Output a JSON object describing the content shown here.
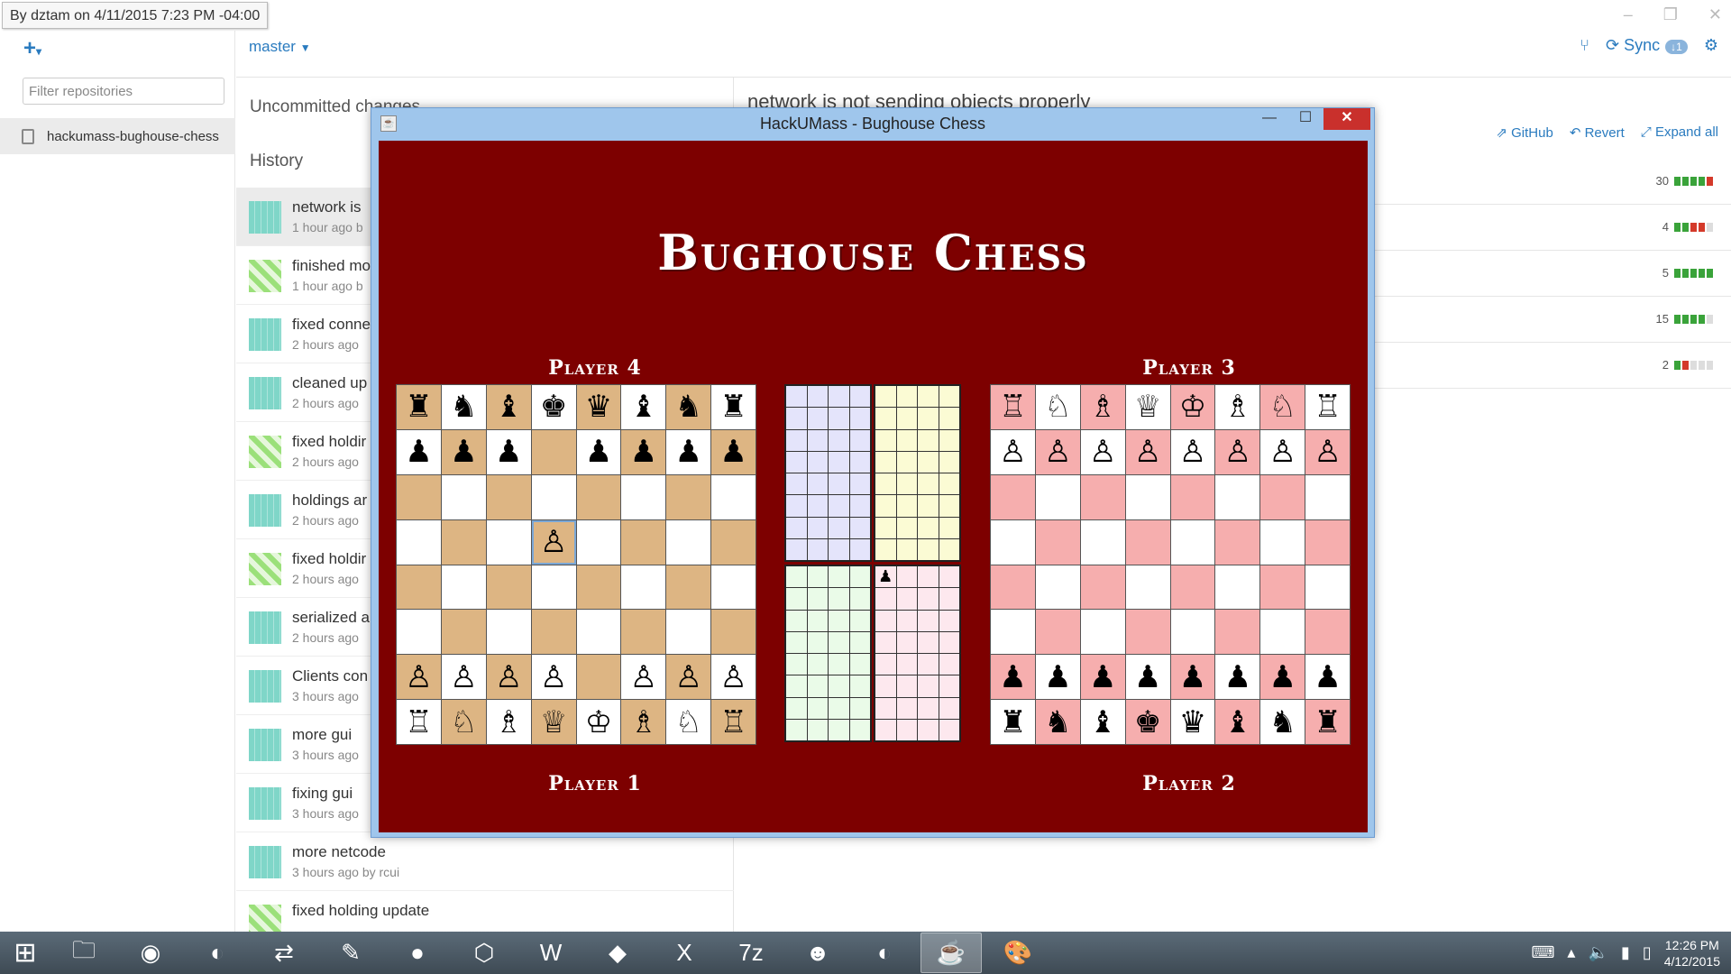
{
  "tooltip": "By dztam on 4/11/2015 7:23 PM -04:00",
  "left_panel": {
    "filter_placeholder": "Filter repositories",
    "repo_name": "hackumass-bughouse-chess"
  },
  "toolbar": {
    "branch": "master",
    "sync_label": "Sync",
    "sync_badge": "1"
  },
  "middle": {
    "uncommitted_label": "Uncommitted changes",
    "history_label": "History",
    "commits": [
      {
        "title": "network is",
        "meta": "1 hour ago b",
        "avatar": "a"
      },
      {
        "title": "finished mo",
        "meta": "1 hour ago b",
        "avatar": "b"
      },
      {
        "title": "fixed conne",
        "meta": "2 hours ago",
        "avatar": "a"
      },
      {
        "title": "cleaned up",
        "meta": "2 hours ago",
        "avatar": "a"
      },
      {
        "title": "fixed holdir",
        "meta": "2 hours ago",
        "avatar": "b"
      },
      {
        "title": "holdings ar",
        "meta": "2 hours ago",
        "avatar": "a"
      },
      {
        "title": "fixed holdir",
        "meta": "2 hours ago",
        "avatar": "b"
      },
      {
        "title": "serialized a",
        "meta": "2 hours ago",
        "avatar": "a"
      },
      {
        "title": "Clients con",
        "meta": "3 hours ago",
        "avatar": "a"
      },
      {
        "title": "more gui",
        "meta": "3 hours ago",
        "avatar": "a"
      },
      {
        "title": "fixing gui",
        "meta": "3 hours ago",
        "avatar": "a"
      },
      {
        "title": "more netcode",
        "meta": "3 hours ago by rcui",
        "avatar": "a"
      },
      {
        "title": "fixed holding update",
        "meta": "",
        "avatar": "b"
      }
    ]
  },
  "right": {
    "commit_title": "network is not sending objects properly",
    "actions": {
      "github": "GitHub",
      "revert": "Revert",
      "expand": "Expand all"
    },
    "files": [
      {
        "count": "30",
        "bars": [
          "#3aa33a",
          "#3aa33a",
          "#3aa33a",
          "#3aa33a",
          "#d43a2a"
        ]
      },
      {
        "count": "4",
        "bars": [
          "#3aa33a",
          "#3aa33a",
          "#d43a2a",
          "#d43a2a",
          "#ddd"
        ]
      },
      {
        "count": "5",
        "bars": [
          "#3aa33a",
          "#3aa33a",
          "#3aa33a",
          "#3aa33a",
          "#3aa33a"
        ]
      },
      {
        "count": "15",
        "bars": [
          "#3aa33a",
          "#3aa33a",
          "#3aa33a",
          "#3aa33a",
          "#ddd"
        ]
      },
      {
        "count": "2",
        "bars": [
          "#3aa33a",
          "#d43a2a",
          "#ddd",
          "#ddd",
          "#ddd"
        ]
      }
    ]
  },
  "game_window": {
    "title": "HackUMass - Bughouse Chess",
    "heading": "Bughouse Chess",
    "players": {
      "p4": "Player 4",
      "p3": "Player 3",
      "p1": "Player 1",
      "p2": "Player 2"
    },
    "boards": {
      "left": {
        "light": "#ffffff",
        "dark": "#ddb583",
        "highlight": [
          3,
          3
        ],
        "rows": [
          [
            "♜",
            "♞",
            "♝",
            "♚",
            "♛",
            "♝",
            "♞",
            "♜"
          ],
          [
            "♟",
            "♟",
            "♟",
            "",
            "♟",
            "♟",
            "♟",
            "♟"
          ],
          [
            "",
            "",
            "",
            "",
            "",
            "",
            "",
            ""
          ],
          [
            "",
            "",
            "",
            "♙",
            "",
            "",
            "",
            ""
          ],
          [
            "",
            "",
            "",
            "",
            "",
            "",
            "",
            ""
          ],
          [
            "",
            "",
            "",
            "",
            "",
            "",
            "",
            ""
          ],
          [
            "♙",
            "♙",
            "♙",
            "♙",
            "",
            "♙",
            "♙",
            "♙"
          ],
          [
            "♖",
            "♘",
            "♗",
            "♕",
            "♔",
            "♗",
            "♘",
            "♖"
          ]
        ]
      },
      "right": {
        "light": "#ffffff",
        "dark": "#f6aeae",
        "rows": [
          [
            "♖",
            "♘",
            "♗",
            "♕",
            "♔",
            "♗",
            "♘",
            "♖"
          ],
          [
            "♙",
            "♙",
            "♙",
            "♙",
            "♙",
            "♙",
            "♙",
            "♙"
          ],
          [
            "",
            "",
            "",
            "",
            "",
            "",
            "",
            ""
          ],
          [
            "",
            "",
            "",
            "",
            "",
            "",
            "",
            ""
          ],
          [
            "",
            "",
            "",
            "",
            "",
            "",
            "",
            ""
          ],
          [
            "",
            "",
            "",
            "",
            "",
            "",
            "",
            ""
          ],
          [
            "♟",
            "♟",
            "♟",
            "♟",
            "♟",
            "♟",
            "♟",
            "♟"
          ],
          [
            "♜",
            "♞",
            "♝",
            "♚",
            "♛",
            "♝",
            "♞",
            "♜"
          ]
        ]
      }
    },
    "holdings": [
      {
        "color": "#e4e4fb",
        "pieces": []
      },
      {
        "color": "#fbfbd4",
        "pieces": []
      },
      {
        "color": "#eafbe8",
        "pieces": []
      },
      {
        "color": "#fde8ee",
        "pieces": [
          "♟"
        ]
      }
    ]
  },
  "taskbar": {
    "apps": [
      {
        "icon": "file-explorer-icon",
        "glyph": "🗀"
      },
      {
        "icon": "chrome-icon",
        "glyph": "◉"
      },
      {
        "icon": "eclipse-icon",
        "glyph": "◐"
      },
      {
        "icon": "network-tool-icon",
        "glyph": "⇄"
      },
      {
        "icon": "notepad-icon",
        "glyph": "✎"
      },
      {
        "icon": "joinme-icon",
        "glyph": "●"
      },
      {
        "icon": "virtualbox-icon",
        "glyph": "⬡"
      },
      {
        "icon": "word-icon",
        "glyph": "W"
      },
      {
        "icon": "git-icon",
        "glyph": "◆"
      },
      {
        "icon": "excel-icon",
        "glyph": "X"
      },
      {
        "icon": "7zip-icon",
        "glyph": "7z"
      },
      {
        "icon": "github-desktop-icon",
        "glyph": "☻"
      },
      {
        "icon": "eclipse-icon-2",
        "glyph": "◐"
      },
      {
        "icon": "java-icon",
        "glyph": "☕"
      },
      {
        "icon": "paint-icon",
        "glyph": "🎨"
      }
    ],
    "active_app": 13,
    "time": "12:26 PM",
    "date": "4/12/2015"
  }
}
